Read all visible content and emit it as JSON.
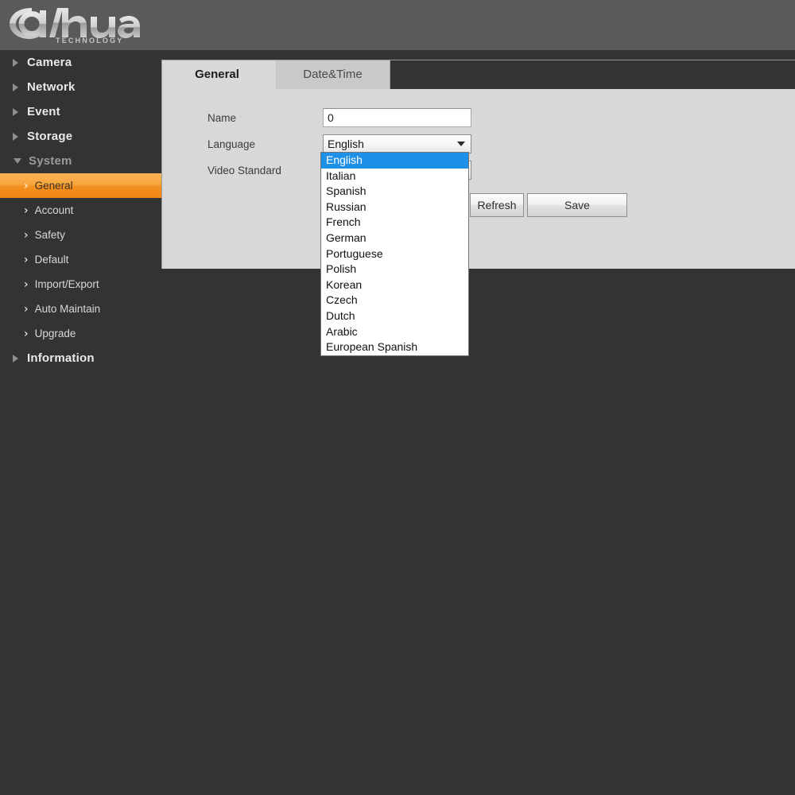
{
  "header": {
    "brand": "alhua",
    "brand_sub": "TECHNOLOGY",
    "logo_icon": "dahua-logo"
  },
  "sidebar": {
    "items": [
      {
        "label": "Camera",
        "expanded": false
      },
      {
        "label": "Network",
        "expanded": false
      },
      {
        "label": "Event",
        "expanded": false
      },
      {
        "label": "Storage",
        "expanded": false
      },
      {
        "label": "System",
        "expanded": true
      }
    ],
    "system_children": [
      {
        "label": "General",
        "active": true
      },
      {
        "label": "Account",
        "active": false
      },
      {
        "label": "Safety",
        "active": false
      },
      {
        "label": "Default",
        "active": false
      },
      {
        "label": "Import/Export",
        "active": false
      },
      {
        "label": "Auto Maintain",
        "active": false
      },
      {
        "label": "Upgrade",
        "active": false
      }
    ],
    "items_after": [
      {
        "label": "Information",
        "expanded": false
      }
    ],
    "chevron_glyph": "›",
    "accent_color": "#f2901f"
  },
  "main": {
    "tabs": [
      {
        "label": "General",
        "active": true
      },
      {
        "label": "Date&Time",
        "active": false
      }
    ],
    "form": {
      "name_label": "Name",
      "name_value": "0",
      "language_label": "Language",
      "language_value": "English",
      "video_standard_label": "Video Standard"
    },
    "buttons": {
      "refresh": "Refresh",
      "save": "Save"
    }
  },
  "dropdown": {
    "open": true,
    "selected": "English",
    "highlight_color": "#1e90e8",
    "options": [
      "English",
      "Italian",
      "Spanish",
      "Russian",
      "French",
      "German",
      "Portuguese",
      "Polish",
      "Korean",
      "Czech",
      "Dutch",
      "Arabic",
      "European Spanish"
    ]
  }
}
